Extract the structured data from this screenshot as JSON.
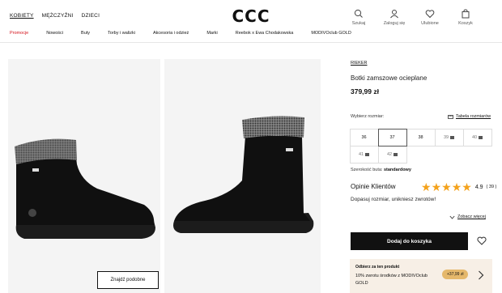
{
  "header": {
    "top_nav": [
      "KOBIETY",
      "MĘŻCZYŹNI",
      "DZIECI"
    ],
    "logo": "CCC",
    "icons": [
      {
        "name": "search-icon",
        "label": "Szukaj"
      },
      {
        "name": "user-icon",
        "label": "Zaloguj się"
      },
      {
        "name": "heart-icon",
        "label": "Ulubione"
      },
      {
        "name": "bag-icon",
        "label": "Koszyk"
      }
    ],
    "categories": [
      "Promocje",
      "Nowości",
      "Buty",
      "Torby i walizki",
      "Akcesoria i odzież",
      "Marki",
      "Reebok x Ewa Chodakowska",
      "MODIVOclub GOLD"
    ]
  },
  "gallery": {
    "find_similar": "Znajdź podobne"
  },
  "product": {
    "brand": "RIEKER",
    "name": "Botki zamszowe ocieplane",
    "price": "379,99 zł",
    "size_label": "Wybierz rozmiar:",
    "size_table": "Tabela rozmiarów",
    "sizes": [
      {
        "label": "36",
        "available": true
      },
      {
        "label": "37",
        "available": true,
        "selected": true
      },
      {
        "label": "38",
        "available": true
      },
      {
        "label": "39",
        "available": false
      },
      {
        "label": "40",
        "available": false
      },
      {
        "label": "41",
        "available": false
      },
      {
        "label": "42",
        "available": false
      }
    ],
    "sole_label": "Szerokość buta:",
    "sole_value": "standardowy"
  },
  "reviews": {
    "title": "Opinie Klientów",
    "rating": "4.9",
    "count": "( 39 )",
    "stars": 5,
    "prompt": "Dopasuj rozmiar, unikniesz zwrotów!",
    "show_more": "Zobacz więcej"
  },
  "cart": {
    "add_label": "Dodaj do koszyka"
  },
  "promo": {
    "title": "Odbierz za ten produkt",
    "text": "10% zwrotu środków z MODIVOclub GOLD",
    "badge": "+37,99 zł"
  },
  "colors": {
    "promo_red": "#d4121b",
    "star": "#f4a21c",
    "badge": "#e5b86b",
    "promo_bg": "#f7efe6"
  }
}
